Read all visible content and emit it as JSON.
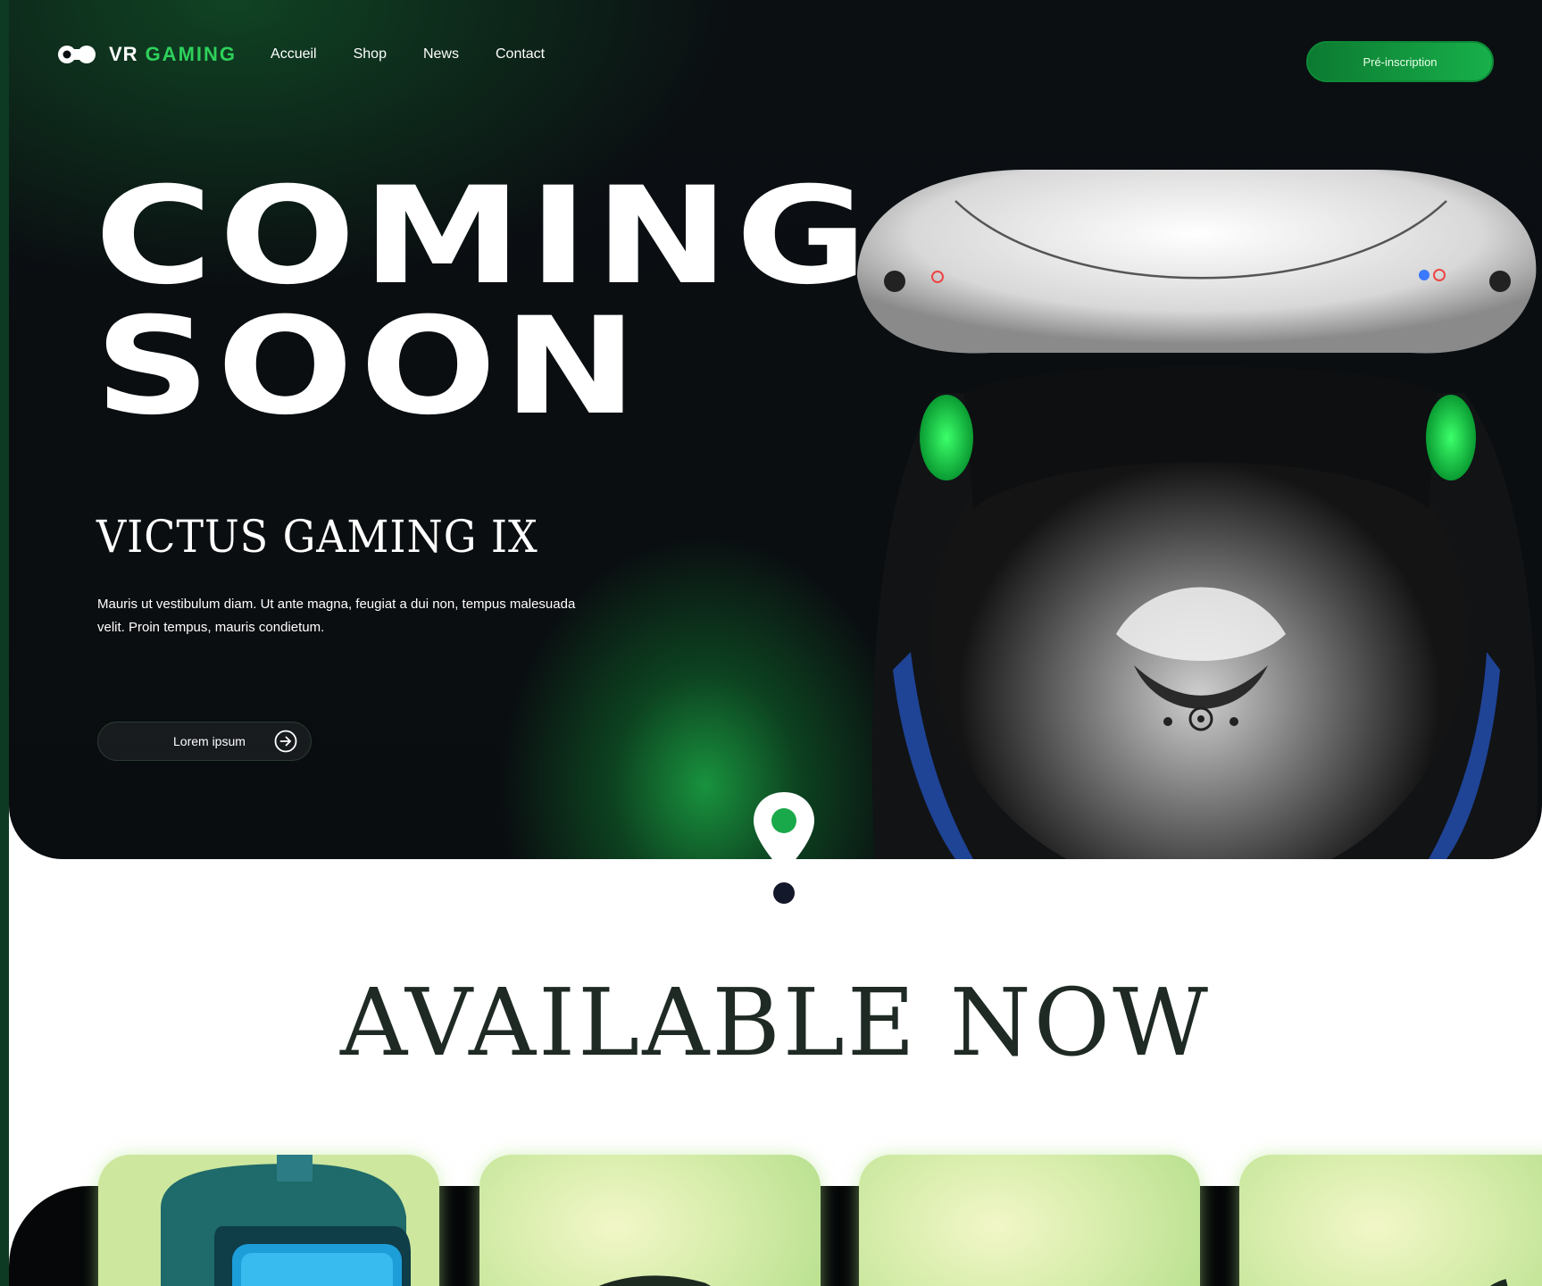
{
  "brand": {
    "vr": "VR",
    "gaming": "GAMING",
    "accent": "#2ed15b"
  },
  "nav": {
    "links": [
      "Accueil",
      "Shop",
      "News",
      "Contact"
    ],
    "cta_label": "Pré-inscription"
  },
  "hero": {
    "title_line1": "COMING",
    "title_line2": "SOON",
    "subtitle": "VICTUS GAMING IX",
    "description": "Mauris ut vestibulum diam. Ut ante magna, feugiat a dui non, tempus malesuada velit. Proin tempus, mauris condietum.",
    "button_label": "Lorem ipsum",
    "button_icon": "arrow-right-circle-icon"
  },
  "section": {
    "title": "AVAILABLE NOW",
    "marker_icon": "location-pin-icon"
  },
  "colors": {
    "dark_bg": "#0b0f12",
    "green_glow": "#1baa46",
    "page_bg": "#ffffff",
    "outer_bg": "#0c3a22"
  }
}
